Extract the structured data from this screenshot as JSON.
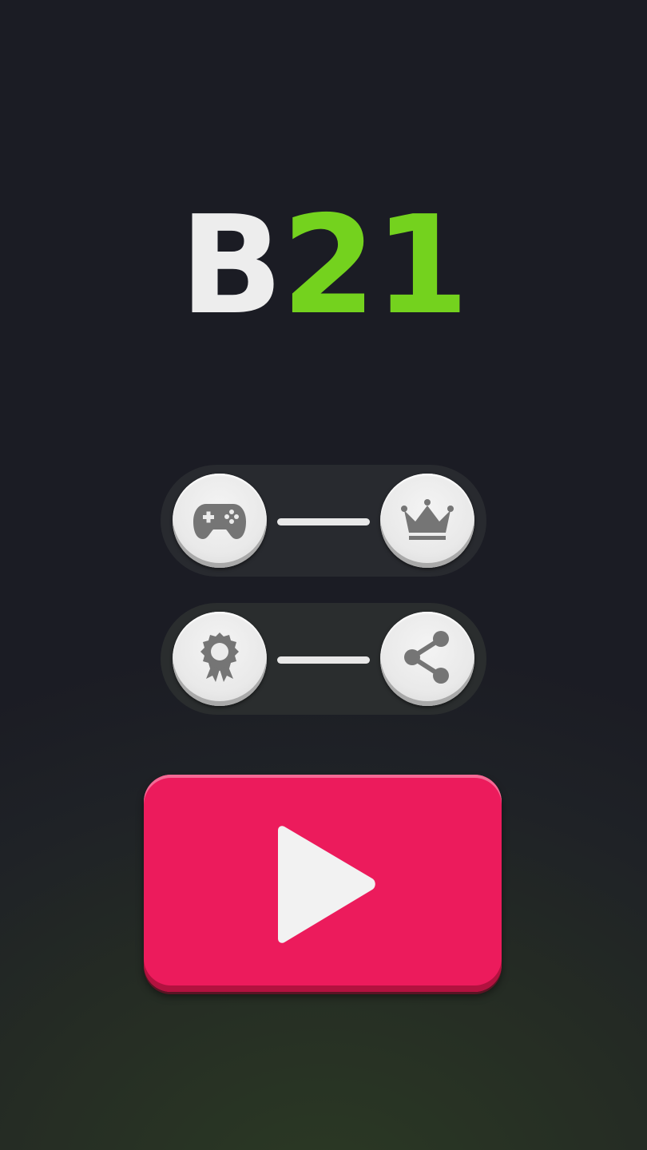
{
  "logo": {
    "letter": "B",
    "number": "21"
  },
  "colors": {
    "background": "#1b1c24",
    "logo_letter": "#ededed",
    "logo_number": "#74d21e",
    "play_button": "#ec1b5c",
    "button_face": "#ebebeb",
    "icon": "#757575"
  },
  "menu": {
    "row1": {
      "left_icon": "gamepad-icon",
      "right_icon": "crown-icon"
    },
    "row2": {
      "left_icon": "award-ribbon-icon",
      "right_icon": "share-icon"
    }
  },
  "play_button": {
    "icon": "play-icon"
  }
}
